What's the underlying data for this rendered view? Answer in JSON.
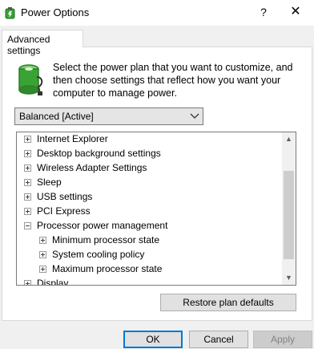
{
  "window": {
    "title": "Power Options",
    "help_label": "?",
    "close_label": "✕"
  },
  "tab": {
    "label": "Advanced settings"
  },
  "description": "Select the power plan that you want to customize, and then choose settings that reflect how you want your computer to manage power.",
  "plan_select": {
    "value": "Balanced [Active]"
  },
  "tree": {
    "items": [
      {
        "label": "Internet Explorer",
        "level": 0,
        "expander": "plus"
      },
      {
        "label": "Desktop background settings",
        "level": 0,
        "expander": "plus"
      },
      {
        "label": "Wireless Adapter Settings",
        "level": 0,
        "expander": "plus"
      },
      {
        "label": "Sleep",
        "level": 0,
        "expander": "plus"
      },
      {
        "label": "USB settings",
        "level": 0,
        "expander": "plus"
      },
      {
        "label": "PCI Express",
        "level": 0,
        "expander": "plus"
      },
      {
        "label": "Processor power management",
        "level": 0,
        "expander": "minus"
      },
      {
        "label": "Minimum processor state",
        "level": 1,
        "expander": "plus"
      },
      {
        "label": "System cooling policy",
        "level": 1,
        "expander": "plus"
      },
      {
        "label": "Maximum processor state",
        "level": 1,
        "expander": "plus"
      },
      {
        "label": "Display",
        "level": 0,
        "expander": "plus"
      }
    ],
    "scroll_up": "▲",
    "scroll_down": "▼"
  },
  "buttons": {
    "restore": "Restore plan defaults",
    "ok": "OK",
    "cancel": "Cancel",
    "apply": "Apply"
  },
  "colors": {
    "focus_border": "#0078d7",
    "battery_green": "#3aa335"
  }
}
